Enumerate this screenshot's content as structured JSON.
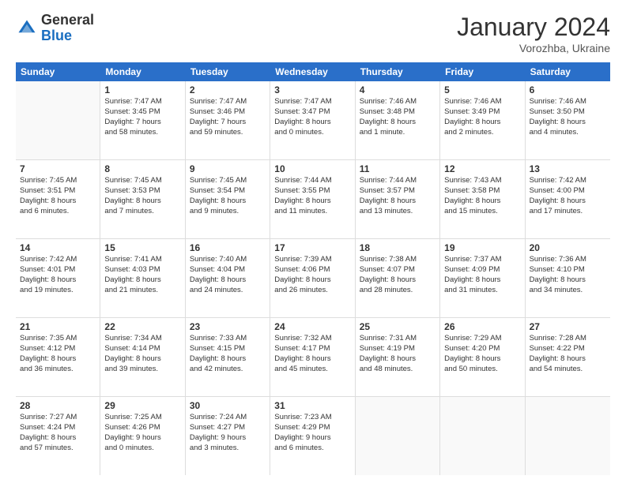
{
  "header": {
    "logo_general": "General",
    "logo_blue": "Blue",
    "month_title": "January 2024",
    "location": "Vorozhba, Ukraine"
  },
  "weekdays": [
    "Sunday",
    "Monday",
    "Tuesday",
    "Wednesday",
    "Thursday",
    "Friday",
    "Saturday"
  ],
  "rows": [
    [
      {
        "num": "",
        "empty": true,
        "lines": []
      },
      {
        "num": "1",
        "empty": false,
        "lines": [
          "Sunrise: 7:47 AM",
          "Sunset: 3:45 PM",
          "Daylight: 7 hours",
          "and 58 minutes."
        ]
      },
      {
        "num": "2",
        "empty": false,
        "lines": [
          "Sunrise: 7:47 AM",
          "Sunset: 3:46 PM",
          "Daylight: 7 hours",
          "and 59 minutes."
        ]
      },
      {
        "num": "3",
        "empty": false,
        "lines": [
          "Sunrise: 7:47 AM",
          "Sunset: 3:47 PM",
          "Daylight: 8 hours",
          "and 0 minutes."
        ]
      },
      {
        "num": "4",
        "empty": false,
        "lines": [
          "Sunrise: 7:46 AM",
          "Sunset: 3:48 PM",
          "Daylight: 8 hours",
          "and 1 minute."
        ]
      },
      {
        "num": "5",
        "empty": false,
        "lines": [
          "Sunrise: 7:46 AM",
          "Sunset: 3:49 PM",
          "Daylight: 8 hours",
          "and 2 minutes."
        ]
      },
      {
        "num": "6",
        "empty": false,
        "lines": [
          "Sunrise: 7:46 AM",
          "Sunset: 3:50 PM",
          "Daylight: 8 hours",
          "and 4 minutes."
        ]
      }
    ],
    [
      {
        "num": "7",
        "empty": false,
        "lines": [
          "Sunrise: 7:45 AM",
          "Sunset: 3:51 PM",
          "Daylight: 8 hours",
          "and 6 minutes."
        ]
      },
      {
        "num": "8",
        "empty": false,
        "lines": [
          "Sunrise: 7:45 AM",
          "Sunset: 3:53 PM",
          "Daylight: 8 hours",
          "and 7 minutes."
        ]
      },
      {
        "num": "9",
        "empty": false,
        "lines": [
          "Sunrise: 7:45 AM",
          "Sunset: 3:54 PM",
          "Daylight: 8 hours",
          "and 9 minutes."
        ]
      },
      {
        "num": "10",
        "empty": false,
        "lines": [
          "Sunrise: 7:44 AM",
          "Sunset: 3:55 PM",
          "Daylight: 8 hours",
          "and 11 minutes."
        ]
      },
      {
        "num": "11",
        "empty": false,
        "lines": [
          "Sunrise: 7:44 AM",
          "Sunset: 3:57 PM",
          "Daylight: 8 hours",
          "and 13 minutes."
        ]
      },
      {
        "num": "12",
        "empty": false,
        "lines": [
          "Sunrise: 7:43 AM",
          "Sunset: 3:58 PM",
          "Daylight: 8 hours",
          "and 15 minutes."
        ]
      },
      {
        "num": "13",
        "empty": false,
        "lines": [
          "Sunrise: 7:42 AM",
          "Sunset: 4:00 PM",
          "Daylight: 8 hours",
          "and 17 minutes."
        ]
      }
    ],
    [
      {
        "num": "14",
        "empty": false,
        "lines": [
          "Sunrise: 7:42 AM",
          "Sunset: 4:01 PM",
          "Daylight: 8 hours",
          "and 19 minutes."
        ]
      },
      {
        "num": "15",
        "empty": false,
        "lines": [
          "Sunrise: 7:41 AM",
          "Sunset: 4:03 PM",
          "Daylight: 8 hours",
          "and 21 minutes."
        ]
      },
      {
        "num": "16",
        "empty": false,
        "lines": [
          "Sunrise: 7:40 AM",
          "Sunset: 4:04 PM",
          "Daylight: 8 hours",
          "and 24 minutes."
        ]
      },
      {
        "num": "17",
        "empty": false,
        "lines": [
          "Sunrise: 7:39 AM",
          "Sunset: 4:06 PM",
          "Daylight: 8 hours",
          "and 26 minutes."
        ]
      },
      {
        "num": "18",
        "empty": false,
        "lines": [
          "Sunrise: 7:38 AM",
          "Sunset: 4:07 PM",
          "Daylight: 8 hours",
          "and 28 minutes."
        ]
      },
      {
        "num": "19",
        "empty": false,
        "lines": [
          "Sunrise: 7:37 AM",
          "Sunset: 4:09 PM",
          "Daylight: 8 hours",
          "and 31 minutes."
        ]
      },
      {
        "num": "20",
        "empty": false,
        "lines": [
          "Sunrise: 7:36 AM",
          "Sunset: 4:10 PM",
          "Daylight: 8 hours",
          "and 34 minutes."
        ]
      }
    ],
    [
      {
        "num": "21",
        "empty": false,
        "lines": [
          "Sunrise: 7:35 AM",
          "Sunset: 4:12 PM",
          "Daylight: 8 hours",
          "and 36 minutes."
        ]
      },
      {
        "num": "22",
        "empty": false,
        "lines": [
          "Sunrise: 7:34 AM",
          "Sunset: 4:14 PM",
          "Daylight: 8 hours",
          "and 39 minutes."
        ]
      },
      {
        "num": "23",
        "empty": false,
        "lines": [
          "Sunrise: 7:33 AM",
          "Sunset: 4:15 PM",
          "Daylight: 8 hours",
          "and 42 minutes."
        ]
      },
      {
        "num": "24",
        "empty": false,
        "lines": [
          "Sunrise: 7:32 AM",
          "Sunset: 4:17 PM",
          "Daylight: 8 hours",
          "and 45 minutes."
        ]
      },
      {
        "num": "25",
        "empty": false,
        "lines": [
          "Sunrise: 7:31 AM",
          "Sunset: 4:19 PM",
          "Daylight: 8 hours",
          "and 48 minutes."
        ]
      },
      {
        "num": "26",
        "empty": false,
        "lines": [
          "Sunrise: 7:29 AM",
          "Sunset: 4:20 PM",
          "Daylight: 8 hours",
          "and 50 minutes."
        ]
      },
      {
        "num": "27",
        "empty": false,
        "lines": [
          "Sunrise: 7:28 AM",
          "Sunset: 4:22 PM",
          "Daylight: 8 hours",
          "and 54 minutes."
        ]
      }
    ],
    [
      {
        "num": "28",
        "empty": false,
        "lines": [
          "Sunrise: 7:27 AM",
          "Sunset: 4:24 PM",
          "Daylight: 8 hours",
          "and 57 minutes."
        ]
      },
      {
        "num": "29",
        "empty": false,
        "lines": [
          "Sunrise: 7:25 AM",
          "Sunset: 4:26 PM",
          "Daylight: 9 hours",
          "and 0 minutes."
        ]
      },
      {
        "num": "30",
        "empty": false,
        "lines": [
          "Sunrise: 7:24 AM",
          "Sunset: 4:27 PM",
          "Daylight: 9 hours",
          "and 3 minutes."
        ]
      },
      {
        "num": "31",
        "empty": false,
        "lines": [
          "Sunrise: 7:23 AM",
          "Sunset: 4:29 PM",
          "Daylight: 9 hours",
          "and 6 minutes."
        ]
      },
      {
        "num": "",
        "empty": true,
        "lines": []
      },
      {
        "num": "",
        "empty": true,
        "lines": []
      },
      {
        "num": "",
        "empty": true,
        "lines": []
      }
    ]
  ]
}
